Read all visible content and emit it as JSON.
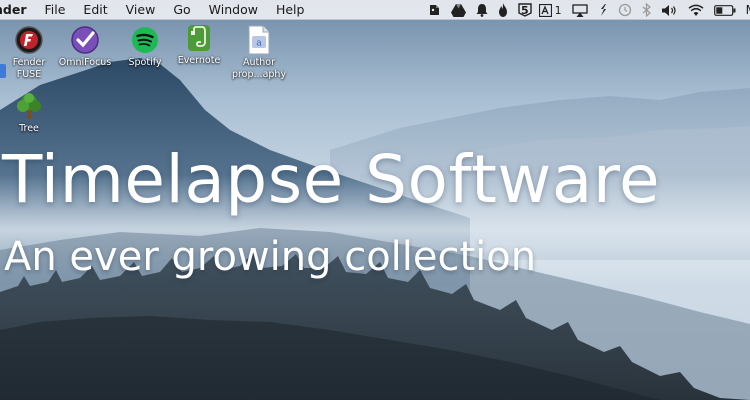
{
  "menubar": {
    "app_name": "nder",
    "menus": [
      "File",
      "Edit",
      "View",
      "Go",
      "Window",
      "Help"
    ],
    "tray": {
      "display_badge_text": "5",
      "adobe_badge_text": "1",
      "clock_text": "M"
    }
  },
  "desktop": {
    "icons": [
      {
        "label_line1": "Fender",
        "label_line2": "FUSE",
        "icon": "fender-fuse-icon"
      },
      {
        "label_line1": "OmniFocus",
        "label_line2": "",
        "icon": "omnifocus-icon"
      },
      {
        "label_line1": "Spotify",
        "label_line2": "",
        "icon": "spotify-icon"
      },
      {
        "label_line1": "Evernote",
        "label_line2": "",
        "icon": "evernote-icon"
      },
      {
        "label_line1": "Author",
        "label_line2": "prop...aphy",
        "icon": "document-icon"
      },
      {
        "label_line1": "Tree",
        "label_line2": "",
        "icon": "tree-icon"
      }
    ]
  },
  "overlay": {
    "title": "Timelapse Software",
    "subtitle": "An ever growing collection"
  },
  "colors": {
    "sky_top": "#8fa8c2",
    "sky_mid": "#c9d8e6",
    "haze": "#dfe7ef",
    "mountain_dark": "#2e4a66",
    "forest": "#26323c",
    "spotify_green": "#1db954",
    "omnifocus_purple": "#7a4fb8",
    "evernote_green": "#4e9a3a"
  }
}
